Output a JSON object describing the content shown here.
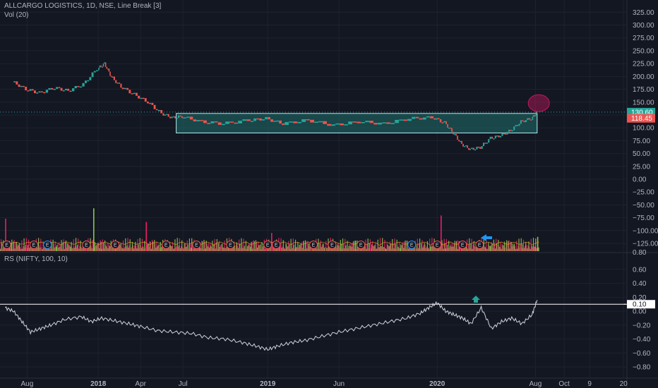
{
  "header": {
    "main_legend": "ALLCARGO LOGISTICS, 1D, NSE, Line Break [3]",
    "volume_legend": "Vol (20)",
    "rs_legend": "RS (NIFTY, 100, 10)"
  },
  "colors": {
    "background": "#131722",
    "grid": "#1e222d",
    "up": "#26a69a",
    "down": "#ef5350",
    "up_volume": "#8bc34a",
    "down_volume": "#e91e63",
    "rs_line": "#d1d4dc",
    "box_fill": "#1f6f6c",
    "box_border": "#b2ebf2",
    "arrow_blue": "#2196f3",
    "arrow_green": "#26a69a",
    "circle": "#c2185b"
  },
  "price_labels": {
    "last": "130.60",
    "prev": "118.45",
    "rs_level": "0.10"
  },
  "earnings_marker": "E",
  "chart_data": [
    {
      "type": "line",
      "name": "price",
      "subtype": "line-break",
      "ylim": [
        -140,
        335
      ],
      "yticks": [
        325,
        300,
        275,
        250,
        225,
        200,
        175,
        150,
        125,
        100,
        75,
        50,
        25,
        0,
        -25,
        -50,
        -75,
        -100,
        -125
      ],
      "ytick_labels": [
        "325.00",
        "300.00",
        "275.00",
        "250.00",
        "225.00",
        "200.00",
        "175.00",
        "150.00",
        "125.00",
        "100.00",
        "75.00",
        "50.00",
        "25.00",
        "0.00",
        "−25.00",
        "−50.00",
        "−75.00",
        "−100.00",
        "−125.00"
      ],
      "x_time": [
        2017.5,
        2017.58,
        2017.66,
        2017.75,
        2017.83,
        2017.92,
        2018.0,
        2018.04,
        2018.08,
        2018.14,
        2018.22,
        2018.3,
        2018.38,
        2018.44,
        2018.5,
        2018.62,
        2018.75,
        2018.9,
        2019.0,
        2019.1,
        2019.25,
        2019.4,
        2019.55,
        2019.7,
        2019.85,
        2019.98,
        2020.05,
        2020.1,
        2020.15,
        2020.2,
        2020.26,
        2020.32,
        2020.38,
        2020.44,
        2020.5,
        2020.56,
        2020.59
      ],
      "values": [
        190,
        175,
        168,
        178,
        172,
        185,
        215,
        225,
        200,
        180,
        165,
        150,
        128,
        120,
        122,
        112,
        108,
        115,
        118,
        108,
        115,
        105,
        112,
        108,
        118,
        120,
        110,
        90,
        68,
        58,
        62,
        80,
        85,
        95,
        112,
        118,
        130.6
      ],
      "last_price": 130.6,
      "prev_level": 118.45,
      "consolidation_box": {
        "x": [
          2018.46,
          2020.59
        ],
        "y": [
          90,
          128
        ]
      }
    },
    {
      "type": "bar",
      "name": "volume",
      "pattern_length_relative_scale": true,
      "spikes": [
        {
          "x": 2017.45,
          "value": 0.5,
          "color": "down"
        },
        {
          "x": 2017.97,
          "value": 0.66,
          "color": "up"
        },
        {
          "x": 2018.28,
          "value": 0.45,
          "color": "down"
        },
        {
          "x": 2019.02,
          "value": 0.28,
          "color": "down"
        },
        {
          "x": 2020.02,
          "value": 0.55,
          "color": "down"
        },
        {
          "x": 2020.59,
          "value": 0.22,
          "color": "up"
        }
      ],
      "earnings_x": [
        2017.46,
        2017.62,
        2017.7,
        2017.93,
        2018.1,
        2018.4,
        2018.58,
        2018.78,
        2019.0,
        2019.05,
        2019.27,
        2019.38,
        2019.55,
        2019.85,
        2020.0,
        2020.15,
        2020.25
      ]
    },
    {
      "type": "line",
      "name": "RS",
      "ylim": [
        -0.88,
        0.7
      ],
      "yticks": [
        0.6,
        0.4,
        0.2,
        0.0,
        -0.2,
        -0.4,
        -0.6,
        -0.8
      ],
      "ytick_labels": [
        "0.60",
        "0.40",
        "0.20",
        "0.00",
        "−0.20",
        "−0.40",
        "−0.60",
        "−0.80"
      ],
      "level": 0.1,
      "x_time": [
        2017.45,
        2017.5,
        2017.55,
        2017.6,
        2017.66,
        2017.72,
        2017.8,
        2017.9,
        2017.96,
        2018.02,
        2018.1,
        2018.18,
        2018.25,
        2018.35,
        2018.45,
        2018.55,
        2018.65,
        2018.75,
        2018.85,
        2018.93,
        2019.0,
        2019.06,
        2019.14,
        2019.22,
        2019.32,
        2019.42,
        2019.52,
        2019.62,
        2019.72,
        2019.82,
        2019.9,
        2019.95,
        2020.0,
        2020.05,
        2020.1,
        2020.15,
        2020.2,
        2020.26,
        2020.32,
        2020.38,
        2020.44,
        2020.5,
        2020.56,
        2020.59
      ],
      "values": [
        0.05,
        0.0,
        -0.15,
        -0.3,
        -0.25,
        -0.2,
        -0.12,
        -0.08,
        -0.15,
        -0.1,
        -0.14,
        -0.18,
        -0.22,
        -0.28,
        -0.3,
        -0.32,
        -0.38,
        -0.4,
        -0.45,
        -0.5,
        -0.55,
        -0.5,
        -0.45,
        -0.42,
        -0.36,
        -0.3,
        -0.25,
        -0.2,
        -0.15,
        -0.1,
        -0.03,
        0.05,
        0.12,
        0.0,
        -0.05,
        -0.1,
        -0.18,
        0.05,
        -0.25,
        -0.15,
        -0.1,
        -0.18,
        -0.05,
        0.16
      ]
    }
  ],
  "x_axis": {
    "ticks": [
      {
        "t": 2017.58,
        "label": "Aug",
        "bold": false
      },
      {
        "t": 2018.0,
        "label": "2018",
        "bold": true
      },
      {
        "t": 2018.25,
        "label": "Apr",
        "bold": false
      },
      {
        "t": 2018.5,
        "label": "Jul",
        "bold": false
      },
      {
        "t": 2019.0,
        "label": "2019",
        "bold": true
      },
      {
        "t": 2019.42,
        "label": "Jun",
        "bold": false
      },
      {
        "t": 2020.0,
        "label": "2020",
        "bold": true
      },
      {
        "t": 2020.58,
        "label": "Aug",
        "bold": false
      },
      {
        "t": 2020.75,
        "label": "Oct",
        "bold": false
      },
      {
        "t": 2020.9,
        "label": "9",
        "bold": false
      },
      {
        "t": 2021.1,
        "label": "20",
        "bold": false
      }
    ]
  }
}
